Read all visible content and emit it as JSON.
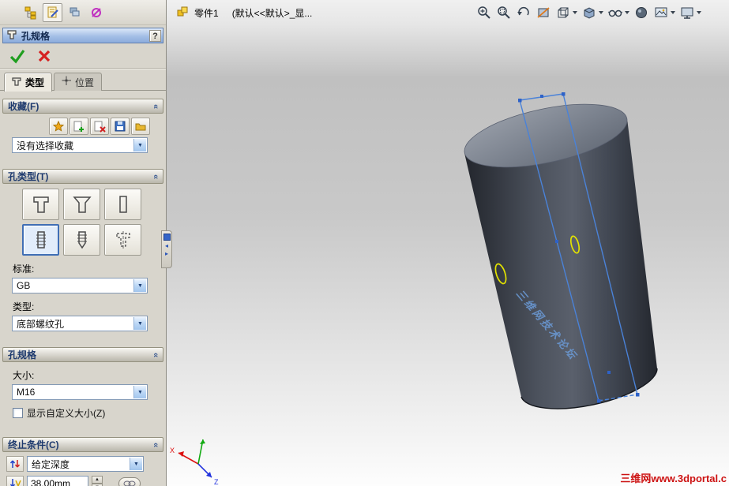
{
  "manager_tabs": {
    "icons": [
      "featuremanager-tree-icon",
      "propertymanager-icon",
      "configurationmanager-icon",
      "dimxpertmanager-icon"
    ],
    "active_index": 1
  },
  "property_manager": {
    "title": "孔规格",
    "help_label": "?",
    "tabs": [
      {
        "label": "类型",
        "active": true
      },
      {
        "label": "位置",
        "active": false
      }
    ],
    "favorites": {
      "title": "收藏(F)",
      "dropdown_value": "没有选择收藏",
      "icons": [
        "favorite-apply-defaults-icon",
        "favorite-add-icon",
        "favorite-delete-icon",
        "favorite-save-icon",
        "favorite-load-icon"
      ]
    },
    "hole_type": {
      "title": "孔类型(T)",
      "type_icons": [
        "counterbore-icon",
        "countersink-icon",
        "hole-icon",
        "straight-tap-icon",
        "tapered-tap-icon",
        "legacy-hole-icon"
      ],
      "selected_index": 3,
      "standard_label": "标准:",
      "standard_value": "GB",
      "type_label": "类型:",
      "type_value": "底部螺纹孔"
    },
    "hole_spec": {
      "title": "孔规格",
      "size_label": "大小:",
      "size_value": "M16",
      "show_custom_label": "显示自定义大小(Z)",
      "show_custom_checked": false
    },
    "end_condition": {
      "title": "终止条件(C)",
      "condition_value": "给定深度",
      "depth_value": "38.00mm"
    }
  },
  "viewport": {
    "document_name": "零件1",
    "configuration_text": "(默认<<默认>_显...",
    "hud_icons": [
      "zoom-in-icon",
      "zoom-area-icon",
      "previous-view-icon",
      "section-view-icon",
      "view-orientation-icon",
      "display-style-icon",
      "hide-show-items-icon",
      "edit-appearance-icon",
      "apply-scene-icon",
      "view-settings-icon"
    ],
    "model_watermark": "三维网技术论坛",
    "site_watermark": "三维网www.3dportal.c",
    "triad": {
      "x_label": "X",
      "z_label": "Z"
    }
  },
  "colors": {
    "sketch_blue": "#4a82d8",
    "preview_yellow": "#e2e200",
    "watermark_red": "#cc1111",
    "model_watermark_blue": "#6b9bd8",
    "cylinder_dark": "#3a3f4a",
    "selection_blue": "#3f6eb5"
  }
}
